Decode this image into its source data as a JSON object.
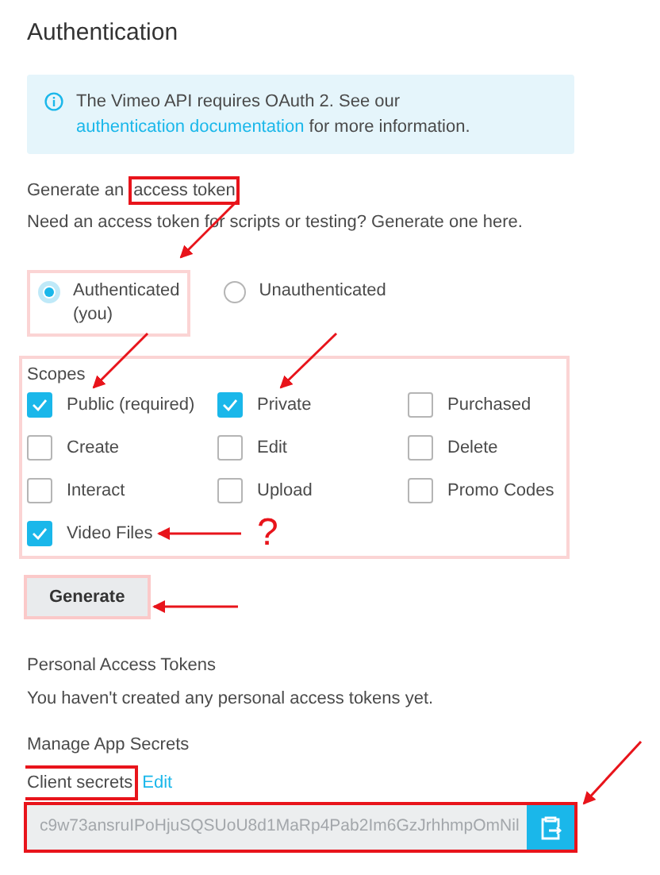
{
  "title": "Authentication",
  "notice": [
    {
      "kind": "text",
      "text": "The Vimeo API requires OAuth 2. See our"
    },
    {
      "kind": "link",
      "text": "authentication documentation"
    },
    {
      "kind": "text",
      "text": "for more information."
    }
  ],
  "generate_heading": [
    {
      "kind": "text",
      "text": "Generate an"
    },
    {
      "kind": "highlight",
      "text": "access token"
    }
  ],
  "generate_hint": "Need an access token for scripts or testing? Generate one here.",
  "auth_options": [
    {
      "label": "Authenticated",
      "sublabel": "(you)",
      "selected": true,
      "highlighted": true
    },
    {
      "label": "Unauthenticated",
      "selected": false,
      "highlighted": false
    }
  ],
  "scopes": {
    "label": "Scopes",
    "items": [
      {
        "label": "Public (required)",
        "checked": true
      },
      {
        "label": "Private",
        "checked": true
      },
      {
        "label": "Purchased",
        "checked": false
      },
      {
        "label": "Create",
        "checked": false
      },
      {
        "label": "Edit",
        "checked": false
      },
      {
        "label": "Delete",
        "checked": false
      },
      {
        "label": "Interact",
        "checked": false
      },
      {
        "label": "Upload",
        "checked": false
      },
      {
        "label": "Promo Codes",
        "checked": false
      },
      {
        "label": "Video Files",
        "checked": true
      }
    ]
  },
  "generate_button": "Generate",
  "personal_tokens": {
    "heading": "Personal Access Tokens",
    "message": "You haven't created any personal access tokens yet."
  },
  "app_secrets": {
    "heading": "Manage App Secrets",
    "label": "Client secrets",
    "edit_link": "Edit",
    "secret_value": "c9w73ansruIPoHjuSQSUoU8d1MaRp4Pab2Im6GzJrhhmpOmNil"
  },
  "annotation_mark": "?"
}
